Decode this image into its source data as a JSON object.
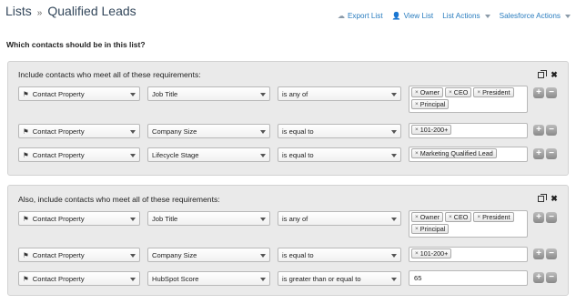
{
  "header": {
    "breadcrumb": {
      "root": "Lists",
      "separator": "»",
      "current": "Qualified Leads"
    },
    "actions": {
      "export": "Export List",
      "view": "View List",
      "list_actions": "List Actions",
      "salesforce_actions": "Salesforce Actions"
    }
  },
  "question": "Which contacts should be in this list?",
  "groups": [
    {
      "title": "Include contacts who meet all of these requirements:",
      "rows": [
        {
          "type": "Contact Property",
          "property": "Job Title",
          "operator": "is any of",
          "tags": [
            "Owner",
            "CEO",
            "President",
            "Principal"
          ]
        },
        {
          "type": "Contact Property",
          "property": "Company Size",
          "operator": "is equal to",
          "tags": [
            "101-200+"
          ]
        },
        {
          "type": "Contact Property",
          "property": "Lifecycle Stage",
          "operator": "is equal to",
          "tags": [
            "Marketing Qualified Lead"
          ]
        }
      ]
    },
    {
      "title": "Also, include contacts who meet all of these requirements:",
      "rows": [
        {
          "type": "Contact Property",
          "property": "Job Title",
          "operator": "is any of",
          "tags": [
            "Owner",
            "CEO",
            "President",
            "Principal"
          ]
        },
        {
          "type": "Contact Property",
          "property": "Company Size",
          "operator": "is equal to",
          "tags": [
            "101-200+"
          ]
        },
        {
          "type": "Contact Property",
          "property": "HubSpot Score",
          "operator": "is greater than or equal to",
          "value": "65"
        }
      ]
    }
  ],
  "icons": {
    "tag_remove": "×",
    "flag": "⚑",
    "add": "+",
    "remove": "−",
    "close": "✖"
  }
}
